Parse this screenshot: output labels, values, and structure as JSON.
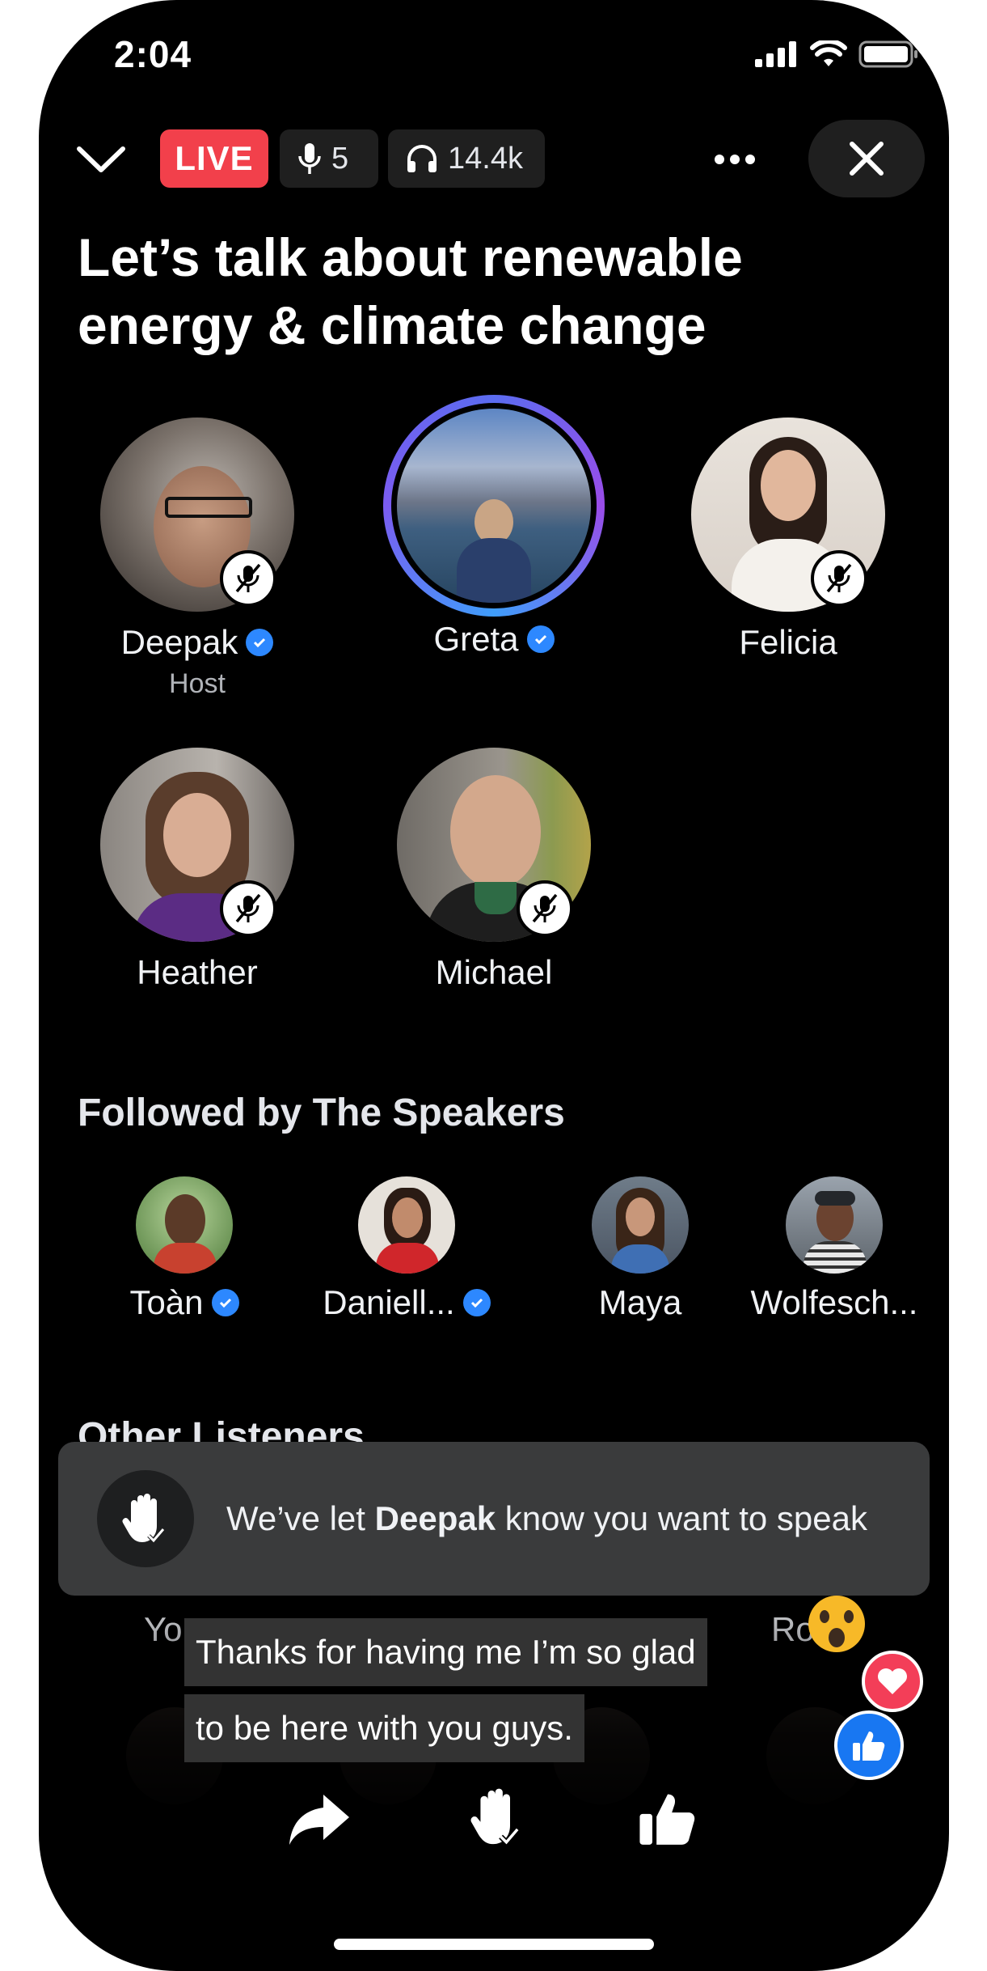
{
  "status_bar": {
    "time": "2:04"
  },
  "header": {
    "live_label": "LIVE",
    "speaker_count": "5",
    "listener_count": "14.4k"
  },
  "room_title": "Let’s talk about renewable energy & climate change",
  "speakers": [
    {
      "name": "Deepak",
      "role": "Host",
      "verified": true,
      "muted": true
    },
    {
      "name": "Greta",
      "verified": true,
      "speaking": true
    },
    {
      "name": "Felicia",
      "muted": true
    },
    {
      "name": "Heather",
      "muted": true
    },
    {
      "name": "Michael",
      "muted": true
    }
  ],
  "followed_section": {
    "title": "Followed by The Speakers",
    "people": [
      {
        "name": "Toàn",
        "verified": true
      },
      {
        "name": "Daniell...",
        "verified": true
      },
      {
        "name": "Maya"
      },
      {
        "name": "Wolfesch..."
      }
    ]
  },
  "other_listeners": {
    "title": "Other Listeners",
    "partial_names": [
      "Yo",
      "Ro"
    ]
  },
  "toast": {
    "prefix": "We’ve let ",
    "name": "Deepak",
    "suffix": " know you want to speak"
  },
  "caption": {
    "line1": "Thanks for having me I’m so glad",
    "line2": "to be here with you guys."
  },
  "colors": {
    "live_red": "#f2404b",
    "verified_blue": "#2d88ff",
    "like_blue": "#1877f2",
    "heart_red": "#f33e58"
  }
}
